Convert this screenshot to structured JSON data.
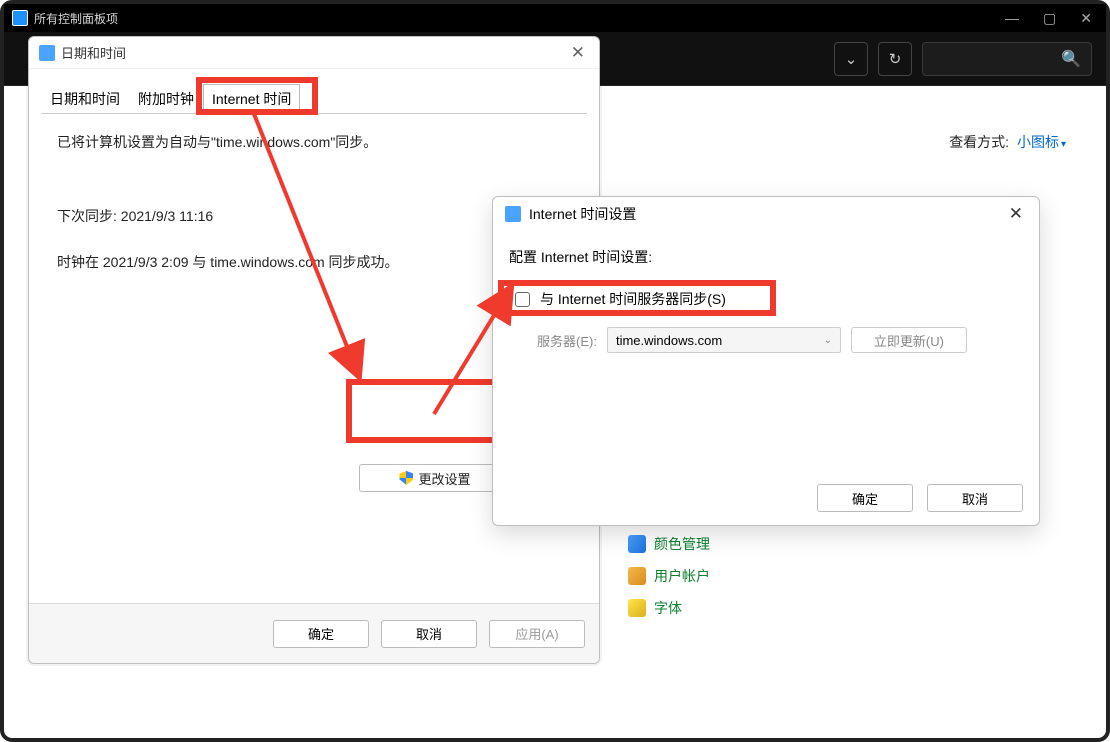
{
  "outer": {
    "title": "所有控制面板项",
    "viewmode_label": "查看方式:",
    "viewmode_value": "小图标",
    "cp_items": [
      "颜色管理",
      "用户帐户",
      "字体"
    ]
  },
  "dt": {
    "title": "日期和时间",
    "tabs": [
      "日期和时间",
      "附加时钟",
      "Internet 时间"
    ],
    "line1": "已将计算机设置为自动与\"time.windows.com\"同步。",
    "line2": "下次同步: 2021/9/3 11:16",
    "line3": "时钟在 2021/9/3 2:09 与 time.windows.com 同步成功。",
    "change_btn": "更改设置",
    "ok": "确定",
    "cancel": "取消",
    "apply": "应用(A)"
  },
  "it": {
    "title": "Internet 时间设置",
    "config_label": "配置 Internet 时间设置:",
    "sync_label": "与 Internet 时间服务器同步(S)",
    "server_label": "服务器(E):",
    "server_value": "time.windows.com",
    "update_btn": "立即更新(U)",
    "ok": "确定",
    "cancel": "取消"
  }
}
